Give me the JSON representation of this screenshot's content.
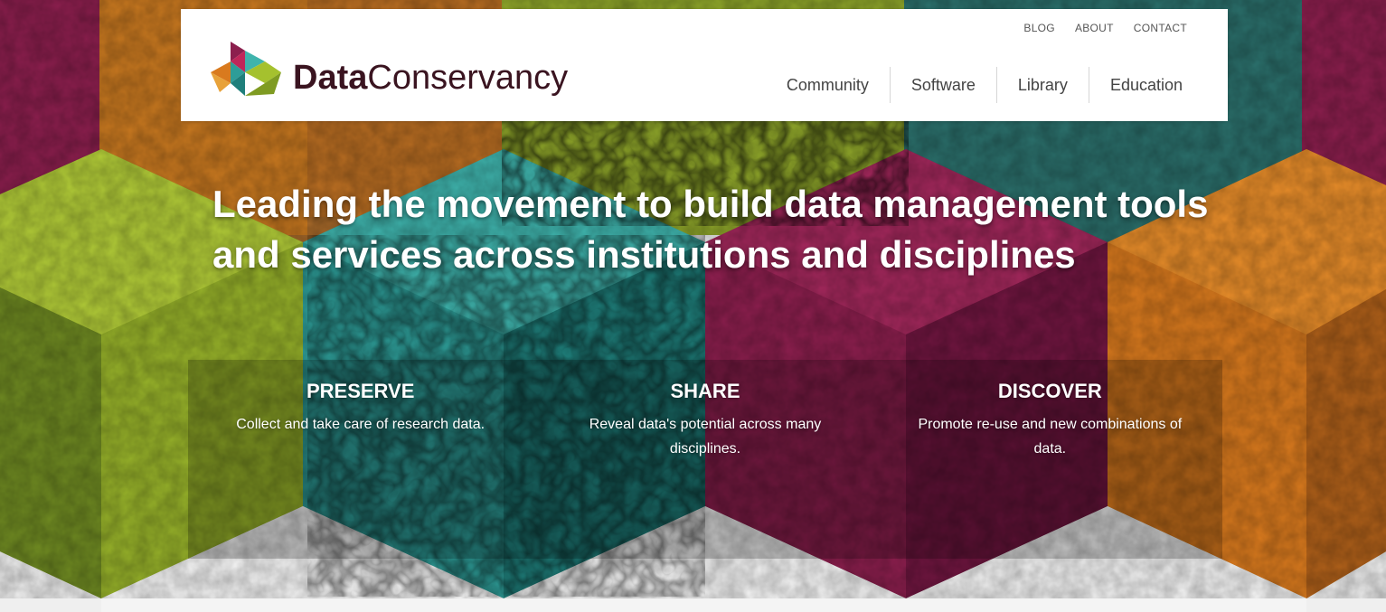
{
  "header": {
    "brand_bold": "Data",
    "brand_light": "Conservancy",
    "utility_nav": [
      "BLOG",
      "ABOUT",
      "CONTACT"
    ],
    "main_nav": [
      "Community",
      "Software",
      "Library",
      "Education"
    ]
  },
  "hero": {
    "headline": "Leading the movement to build data management tools and services across institutions and disciplines"
  },
  "pillars": [
    {
      "title": "PRESERVE",
      "description": "Collect and take care of research data."
    },
    {
      "title": "SHARE",
      "description": "Reveal data's potential across many disciplines."
    },
    {
      "title": "DISCOVER",
      "description": "Promote re-use and new combinations of data."
    }
  ],
  "colors": {
    "magenta": "#8c1f4e",
    "orange": "#d97a1e",
    "lime": "#a5c12e",
    "teal": "#2e9d98",
    "dark_green": "#3e5a22",
    "brand_text": "#3a1420"
  }
}
